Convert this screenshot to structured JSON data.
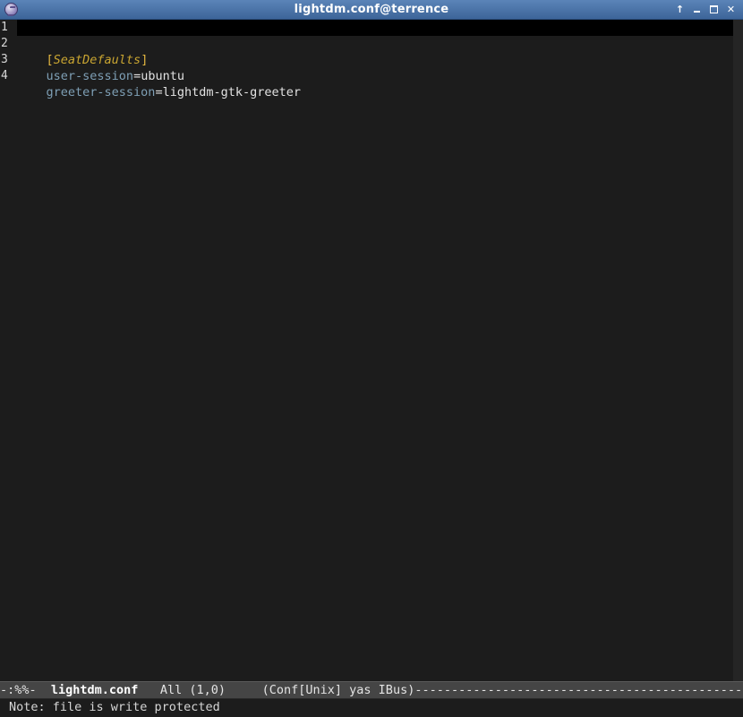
{
  "window": {
    "title": "lightdm.conf@terrence",
    "buttons": {
      "up": "↑",
      "minimize": "minimize",
      "maximize": "maximize",
      "close": "✕"
    }
  },
  "editor": {
    "line_numbers": [
      "1",
      "2",
      "3",
      "4"
    ],
    "lines": [
      {
        "text": ""
      },
      {
        "open": "[",
        "section": "SeatDefaults",
        "close": "]"
      },
      {
        "key": "user-session",
        "eq": "=",
        "value": "ubuntu"
      },
      {
        "key": "greeter-session",
        "eq": "=",
        "value": "lightdm-gtk-greeter"
      }
    ]
  },
  "modeline": {
    "status": "-:%%-",
    "buffer_name": "lightdm.conf",
    "position": "All (1,0)",
    "modes": "(Conf[Unix] yas IBus)",
    "filler": "-------------------------------------------------"
  },
  "echo_area": {
    "message": "Note: file is write protected"
  },
  "colors": {
    "background": "#1c1c1c",
    "titlebar": "#4a72a8",
    "section": "#c9a531",
    "key": "#7e9fb5",
    "modeline": "#454545"
  }
}
